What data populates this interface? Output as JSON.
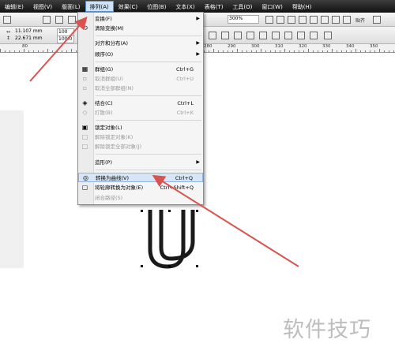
{
  "menubar": {
    "items": [
      {
        "label": "编辑(E)"
      },
      {
        "label": "视图(V)"
      },
      {
        "label": "版面(L)"
      },
      {
        "label": "排列(A)"
      },
      {
        "label": "效果(C)"
      },
      {
        "label": "位图(B)"
      },
      {
        "label": "文本(X)"
      },
      {
        "label": "表格(T)"
      },
      {
        "label": "工具(O)"
      },
      {
        "label": "窗口(W)"
      },
      {
        "label": "帮助(H)"
      }
    ],
    "active": "排列(A)"
  },
  "toolbar": {
    "zoom": "300%",
    "snap_label": "贴齐"
  },
  "propbar": {
    "width": "11.107 mm",
    "height": "22.671 mm",
    "scale_x": "100",
    "scale_y": "100.0"
  },
  "ruler": {
    "labels": [
      "80",
      "280",
      "290",
      "300",
      "310",
      "320",
      "330",
      "340",
      "350"
    ]
  },
  "arrange_menu": {
    "items": [
      {
        "label": "变换(F)",
        "shortcut": "",
        "submenu": true,
        "enabled": true,
        "icon": ""
      },
      {
        "label": "清除变换(M)",
        "shortcut": "",
        "submenu": false,
        "enabled": true,
        "icon": "clear-transform-icon"
      },
      {
        "label": "对齐和分布(A)",
        "shortcut": "",
        "submenu": true,
        "enabled": true,
        "icon": ""
      },
      {
        "label": "顺序(O)",
        "shortcut": "",
        "submenu": true,
        "enabled": true,
        "icon": ""
      },
      {
        "label": "群组(G)",
        "shortcut": "Ctrl+G",
        "submenu": false,
        "enabled": true,
        "icon": "group-icon"
      },
      {
        "label": "取消群组(U)",
        "shortcut": "Ctrl+U",
        "submenu": false,
        "enabled": false,
        "icon": "ungroup-icon"
      },
      {
        "label": "取消全部群组(N)",
        "shortcut": "",
        "submenu": false,
        "enabled": false,
        "icon": "ungroup-all-icon"
      },
      {
        "label": "结合(C)",
        "shortcut": "Ctrl+L",
        "submenu": false,
        "enabled": true,
        "icon": "combine-icon"
      },
      {
        "label": "打散(B)",
        "shortcut": "Ctrl+K",
        "submenu": false,
        "enabled": false,
        "icon": "break-apart-icon"
      },
      {
        "label": "锁定对象(L)",
        "shortcut": "",
        "submenu": false,
        "enabled": true,
        "icon": "lock-icon"
      },
      {
        "label": "解除锁定对象(K)",
        "shortcut": "",
        "submenu": false,
        "enabled": false,
        "icon": "unlock-icon"
      },
      {
        "label": "解除锁定全部对象(J)",
        "shortcut": "",
        "submenu": false,
        "enabled": false,
        "icon": "unlock-all-icon"
      },
      {
        "label": "造形(P)",
        "shortcut": "",
        "submenu": true,
        "enabled": true,
        "icon": ""
      },
      {
        "label": "转换为曲线(V)",
        "shortcut": "Ctrl+Q",
        "submenu": false,
        "enabled": true,
        "icon": "convert-curve-icon",
        "highlighted": true
      },
      {
        "label": "将轮廓转换为对象(E)",
        "shortcut": "Ctrl+Shift+Q",
        "submenu": false,
        "enabled": true,
        "icon": "outline-object-icon"
      },
      {
        "label": "闭合路径(S)",
        "shortcut": "",
        "submenu": false,
        "enabled": false,
        "icon": ""
      }
    ]
  },
  "watermark": {
    "text": "软件技巧"
  },
  "colors": {
    "arrow": "#d9534f",
    "shape_stroke": "#1a1a1a",
    "highlight": "#d6e6f7"
  }
}
